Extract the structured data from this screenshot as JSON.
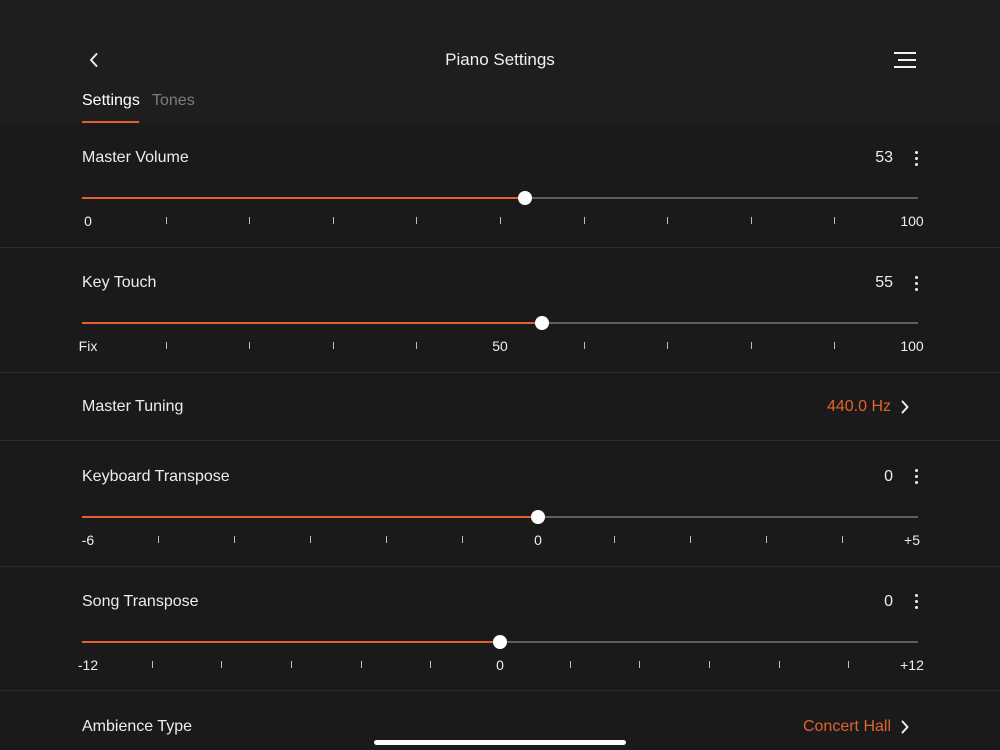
{
  "header": {
    "title": "Piano Settings"
  },
  "tabs": [
    {
      "label": "Settings",
      "active": true
    },
    {
      "label": "Tones",
      "active": false
    }
  ],
  "colors": {
    "accent": "#e2622d",
    "background": "#1c1c1d",
    "text": "#ededed",
    "muted_tab": "#7d7d7d"
  },
  "settings": {
    "master_volume": {
      "label": "Master Volume",
      "value": "53",
      "min": 0,
      "max": 100,
      "current": 53,
      "tick_labels": [
        {
          "text": "0",
          "at": 0
        },
        {
          "text": "100",
          "at": 100
        }
      ],
      "tick_count": 11
    },
    "key_touch": {
      "label": "Key Touch",
      "value": "55",
      "min": 0,
      "max": 100,
      "current": 55,
      "tick_labels": [
        {
          "text": "Fix",
          "at": 0
        },
        {
          "text": "50",
          "at": 50
        },
        {
          "text": "100",
          "at": 100
        }
      ],
      "tick_count": 11
    },
    "master_tuning": {
      "label": "Master Tuning",
      "value": "440.0 Hz"
    },
    "keyboard_transpose": {
      "label": "Keyboard Transpose",
      "value": "0",
      "min": -6,
      "max": 5,
      "current": 0,
      "tick_labels": [
        {
          "text": "-6",
          "at": -6
        },
        {
          "text": "0",
          "at": 0
        },
        {
          "text": "+5",
          "at": 5
        }
      ],
      "tick_count": 12
    },
    "song_transpose": {
      "label": "Song Transpose",
      "value": "0",
      "min": -12,
      "max": 12,
      "current": 0,
      "tick_labels": [
        {
          "text": "-12",
          "at": -12
        },
        {
          "text": "0",
          "at": 0
        },
        {
          "text": "+12",
          "at": 12
        }
      ],
      "tick_count": 13
    },
    "ambience_type": {
      "label": "Ambience Type",
      "value": "Concert Hall"
    }
  },
  "icons": {
    "back": "chevron-left-icon",
    "menu": "hamburger-menu-icon",
    "more": "more-vertical-icon",
    "forward": "chevron-right-icon"
  }
}
